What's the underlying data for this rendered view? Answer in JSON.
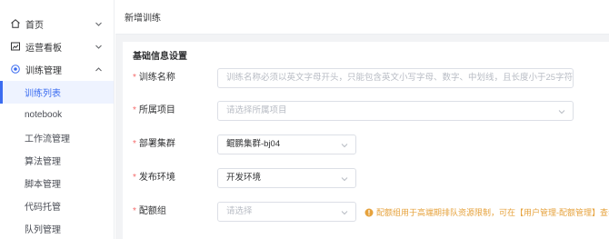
{
  "sidebar": {
    "menu": [
      {
        "label": "首页",
        "icon": "home-icon",
        "expanded": false
      },
      {
        "label": "运营看板",
        "icon": "dashboard-icon",
        "expanded": false
      },
      {
        "label": "训练管理",
        "icon": "training-icon",
        "expanded": true
      }
    ],
    "sub_items": [
      {
        "label": "训练列表",
        "active": true
      },
      {
        "label": "notebook",
        "active": false
      },
      {
        "label": "工作流管理",
        "active": false
      },
      {
        "label": "算法管理",
        "active": false
      },
      {
        "label": "脚本管理",
        "active": false
      },
      {
        "label": "代码托管",
        "active": false
      },
      {
        "label": "队列管理",
        "active": false
      }
    ]
  },
  "header": {
    "title": "新增训练"
  },
  "form": {
    "section_title": "基础信息设置",
    "fields": [
      {
        "label": "训练名称",
        "required": true,
        "placeholder": "训练名称必须以英文字母开头，只能包含英文小写字母、数字、中划线，且长度小于25字符",
        "value": "",
        "type": "text"
      },
      {
        "label": "所属项目",
        "required": true,
        "placeholder": "请选择所属项目",
        "value": "",
        "type": "select"
      },
      {
        "label": "部署集群",
        "required": true,
        "placeholder": "",
        "value": "鲲鹏集群-bj04",
        "type": "select"
      },
      {
        "label": "发布环境",
        "required": true,
        "placeholder": "",
        "value": "开发环境",
        "type": "select"
      },
      {
        "label": "配额组",
        "required": true,
        "placeholder": "请选择",
        "value": "",
        "type": "select"
      }
    ],
    "quota_hint": "配额组用于高端期排队资源限制，可在【用户管理-配额管理】查看更多"
  },
  "colors": {
    "accent": "#3b6cf0",
    "required": "#f56c6c",
    "warning": "#e6a23c"
  }
}
